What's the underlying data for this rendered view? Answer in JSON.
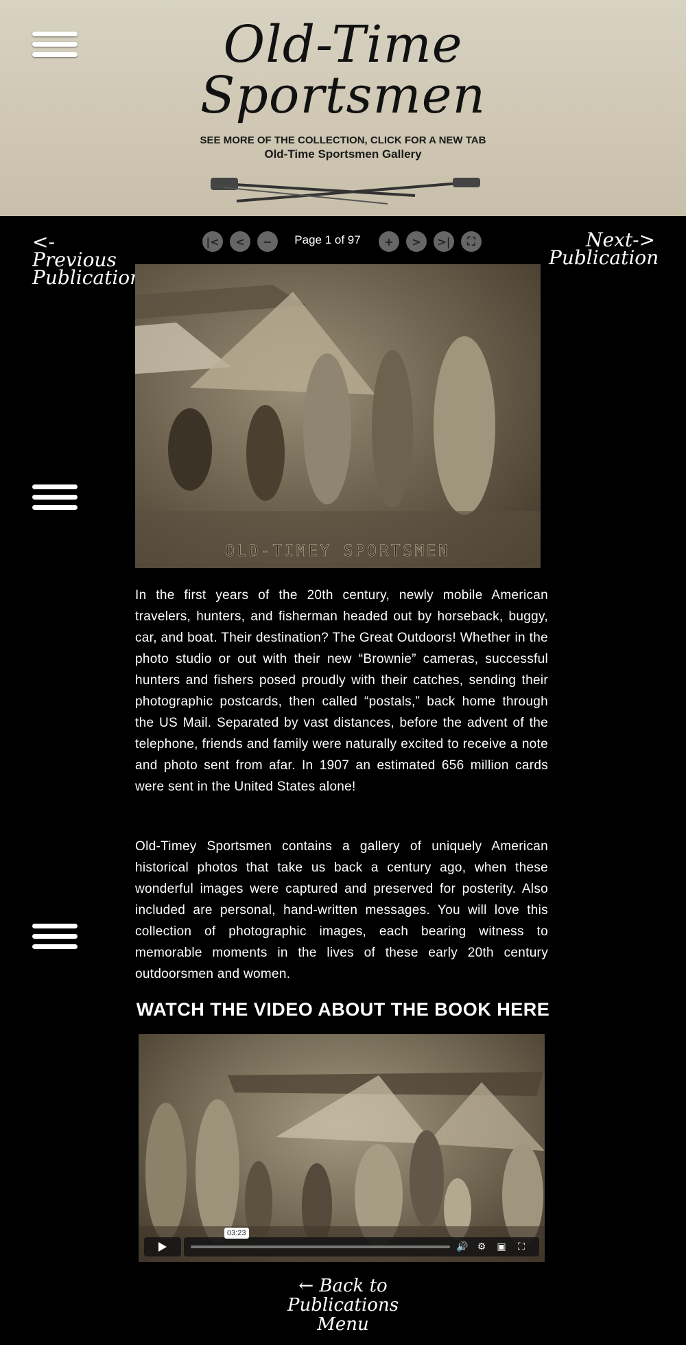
{
  "header": {
    "title_line1": "Old-Time",
    "title_line2": "Sportsmen",
    "gallery_note": "SEE MORE OF THE COLLECTION, CLICK FOR A NEW TAB",
    "gallery_link": "Old-Time Sportsmen Gallery"
  },
  "nav": {
    "previous_line1": "<-Previous",
    "previous_line2": "Publication",
    "next_line1": "Next->",
    "next_line2": "Publication"
  },
  "viewer": {
    "page_indicator": "Page 1 of 97",
    "photo_caption": "OLD-TIMEY SPORTSMEN"
  },
  "article": {
    "paragraph1": "In the first years of the 20th century, newly mobile American travelers, hunters, and fisherman headed out by horseback, buggy, car, and boat. Their destination? The Great Outdoors! Whether in the photo studio or out with their new “Brownie” cameras, successful hunters and fishers posed proudly with their catches, sending their photographic postcards, then called “postals,” back home through the US Mail. Separated by vast distances, before the advent of the telephone, friends and family were naturally excited to receive a note and photo sent from afar. In 1907 an estimated 656 million cards were sent in the United States alone!",
    "paragraph2": "Old-Timey Sportsmen contains a gallery of uniquely American historical photos that take us back a century ago, when these wonderful images were captured and preserved for posterity. Also included are personal, hand-written messages. You will love this collection of photographic images, each bearing witness to memorable moments in the lives of these early 20th century outdoorsmen and women."
  },
  "video": {
    "heading": "WATCH THE VIDEO ABOUT THE BOOK HERE",
    "duration": "03:23"
  },
  "footer": {
    "back_line1": "← Back to",
    "back_line2": "Publications",
    "back_line3": "Menu"
  },
  "icons": [
    "menu-icon",
    "first-page-icon",
    "previous-page-icon",
    "zoom-out-icon",
    "zoom-in-icon",
    "next-page-icon",
    "last-page-icon",
    "fullscreen-icon",
    "play-icon",
    "volume-icon",
    "settings-icon",
    "picture-in-picture-icon",
    "video-fullscreen-icon"
  ],
  "colors": {
    "header_bg": "#d4cdbb",
    "page_bg": "#000000",
    "control_gray": "#666666"
  }
}
